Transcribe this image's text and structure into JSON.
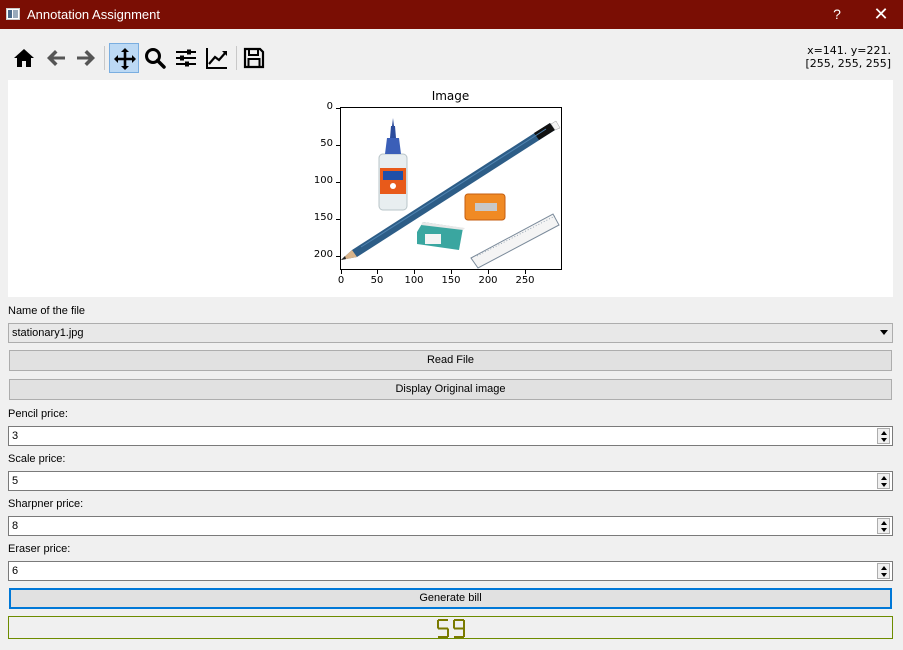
{
  "window": {
    "title": "Annotation Assignment",
    "help_label": "?",
    "close_label": "✕"
  },
  "toolbar": {
    "tools": [
      {
        "name": "home-icon",
        "active": false
      },
      {
        "name": "back-icon",
        "active": false
      },
      {
        "name": "forward-icon",
        "active": false
      },
      {
        "name": "pan-icon",
        "active": true
      },
      {
        "name": "zoom-icon",
        "active": false
      },
      {
        "name": "configure-subplots-icon",
        "active": false
      },
      {
        "name": "edit-axis-icon",
        "active": false
      },
      {
        "name": "save-icon",
        "active": false
      }
    ],
    "coords_line1": "x=141. y=221.",
    "coords_line2": "[255, 255, 255]"
  },
  "figure": {
    "title": "Image",
    "x_ticks": [
      "0",
      "50",
      "100",
      "150",
      "200",
      "250"
    ],
    "y_ticks": [
      "0",
      "50",
      "100",
      "150",
      "200"
    ],
    "xlim": [
      0,
      300
    ],
    "ylim": [
      220,
      0
    ]
  },
  "form": {
    "file_label": "Name of the file",
    "file_value": "stationary1.jpg",
    "read_button": "Read File",
    "display_button": "Display Original image",
    "pencil_label": "Pencil price:",
    "pencil_value": "3",
    "scale_label": "Scale price:",
    "scale_value": "5",
    "sharpner_label": "Sharpner price:",
    "sharpner_value": "8",
    "eraser_label": "Eraser price:",
    "eraser_value": "6",
    "generate_button": "Generate bill",
    "total": "59"
  },
  "colors": {
    "titlebar": "#7a0e04",
    "lcd_digits": "#7a7a00",
    "lcd_border": "#6d8c00",
    "focus": "#0078d7"
  }
}
